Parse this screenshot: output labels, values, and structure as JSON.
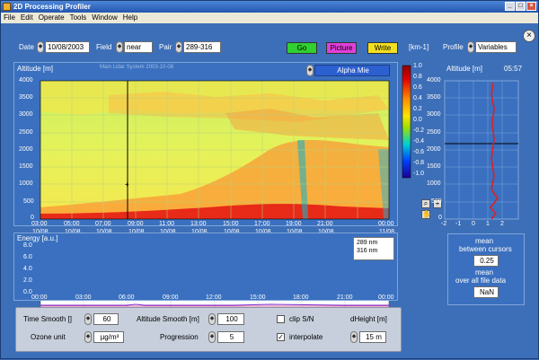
{
  "window": {
    "title": "2D Processing Profiler",
    "btn_min": "_",
    "btn_max": "□",
    "btn_close": "×"
  },
  "menu": [
    "File",
    "Edit",
    "Operate",
    "Tools",
    "Window",
    "Help"
  ],
  "toolbar": {
    "date_label": "Date",
    "date_value": "10/08/2003",
    "field_label": "Field",
    "field_value": "near",
    "pair_label": "Pair",
    "pair_value": "289-316",
    "go_label": "Go",
    "picture_label": "Picture",
    "write_label": "Write",
    "unit_label": "[km-1]",
    "profile_label": "Profile",
    "profile_value": "Variables"
  },
  "main_plot": {
    "ylabel": "Altitude [m]",
    "subtitle": "Main Lidar System  2003-10-08",
    "mode": "Alpha Mie",
    "y_ticks": [
      "4000",
      "3500",
      "3000",
      "2500",
      "2000",
      "1500",
      "1000",
      "500",
      "0"
    ],
    "x_ticks_time": [
      "03:00",
      "05:00",
      "07:00",
      "09:00",
      "11:00",
      "13:00",
      "15:00",
      "17:00",
      "19:00",
      "21:00",
      "00:00"
    ],
    "x_ticks_date": [
      "10/08",
      "10/08",
      "10/08",
      "10/08",
      "10/08",
      "10/08",
      "10/08",
      "10/08",
      "10/08",
      "10/08",
      "11/08"
    ],
    "colorbar_ticks": [
      "1.0",
      "0.8",
      "0.6",
      "0.4",
      "0.2",
      "0.0",
      "-0.2",
      "-0.4",
      "-0.6",
      "-0.8",
      "-1.0"
    ]
  },
  "profile_plot": {
    "ylabel": "Altitude [m]",
    "time": "05:57",
    "y_ticks": [
      "4000",
      "3500",
      "3000",
      "2500",
      "2000",
      "1500",
      "1000",
      "500",
      "0"
    ],
    "x_ticks": [
      "-2",
      "-1",
      "0",
      "1",
      "2"
    ]
  },
  "energy_plot": {
    "ylabel": "Energy [a.u.]",
    "y_ticks": [
      "8.0",
      "6.0",
      "4.0",
      "2.0",
      "0.0"
    ],
    "x_ticks": [
      "00:00",
      "03:00",
      "06:00",
      "09:00",
      "12:00",
      "15:00",
      "18:00",
      "21:00",
      "00:00"
    ],
    "legend": [
      "289 nm",
      "316 nm"
    ]
  },
  "stats": {
    "mean_cursors_label1": "mean",
    "mean_cursors_label2": "between cursors",
    "mean_cursors_value": "0.25",
    "mean_all_label1": "mean",
    "mean_all_label2": "over all file data",
    "mean_all_value": "NaN"
  },
  "controls": {
    "time_smooth_label": "Time Smooth []",
    "time_smooth_value": "60",
    "altitude_smooth_label": "Altitude Smooth [m]",
    "altitude_smooth_value": "100",
    "ozone_unit_label": "Ozone unit",
    "ozone_unit_value": "µg/m³",
    "progression_label": "Progression",
    "progression_value": "5",
    "clip_label": "clip S/N",
    "clip_checked": false,
    "interpolate_label": "interpolate",
    "interpolate_checked": true,
    "dheight_label": "dHeight [m]",
    "dheight_value": "15 m"
  },
  "colors": {
    "go": "#2fd02f",
    "picture": "#e040d8",
    "write": "#f2e020"
  }
}
